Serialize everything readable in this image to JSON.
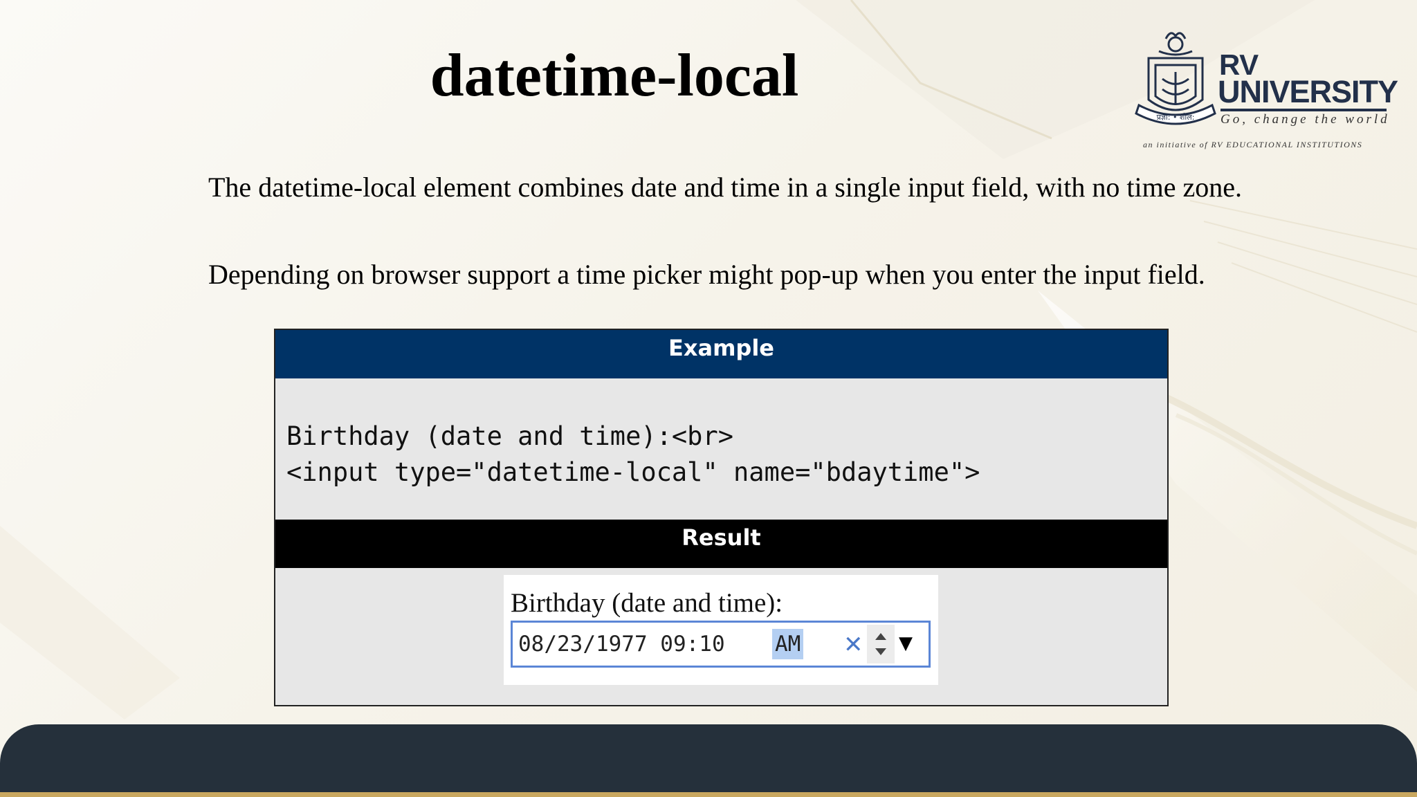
{
  "slide": {
    "title": "datetime-local",
    "paragraph1": "The datetime-local element combines date and time in a single input field, with no time zone.",
    "paragraph2": "Depending on browser support a time picker might pop-up when you enter the input field."
  },
  "logo": {
    "line1": "RV",
    "line2": "UNIVERSITY",
    "tagline": "Go, change the world",
    "initiative": "an initiative of RV EDUCATIONAL INSTITUTIONS",
    "emblem_text": "प्रज्ञा: • शील:",
    "colors": {
      "navy": "#22304a"
    }
  },
  "example": {
    "header": "Example",
    "code_line1": "Birthday (date and time):<br>",
    "code_line2": "<input type=\"datetime-local\" name=\"bdaytime\">",
    "result_header": "Result",
    "result_label": "Birthday (date and time):",
    "input_value": "08/23/1977 09:10",
    "input_ampm": "AM",
    "clear_icon": "close-icon",
    "dropdown_icon": "triangle-down-icon",
    "colors": {
      "header_bg": "#003366",
      "result_bg": "#000000",
      "input_border": "#5b86d6",
      "highlight": "#b4cff2"
    }
  },
  "footer": {
    "colors": {
      "bar": "#25303b",
      "accent": "#c9a75f"
    }
  }
}
